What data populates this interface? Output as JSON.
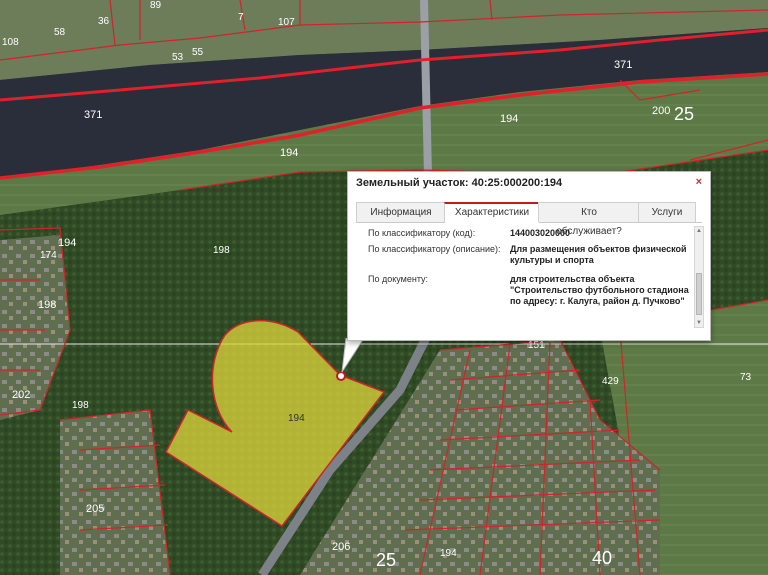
{
  "map": {
    "parcel_labels": [
      "89",
      "36",
      "58",
      "108",
      "107",
      "7",
      "53",
      "55",
      "371",
      "371",
      "194",
      "200",
      "25",
      "194",
      "194",
      "198",
      "174",
      "198",
      "202",
      "198",
      "205",
      "206",
      "25",
      "194",
      "40",
      "73",
      "429",
      "151"
    ],
    "selected_parcel_label": "194"
  },
  "popup": {
    "title": "Земельный участок: 40:25:000200:194",
    "close_icon": "×",
    "tabs": [
      "Информация",
      "Характеристики",
      "Кто обслуживает?",
      "Услуги"
    ],
    "active_tab": "Характеристики",
    "rows": [
      {
        "key": "По классификатору (код):",
        "value": "144003020000"
      },
      {
        "key": "По классификатору (описание):",
        "value": "Для размещения объектов физической культуры и спорта"
      },
      {
        "key": "По документу:",
        "value": "для строительства объекта \"Строительство футбольного стадиона по адресу: г. Калуга, район д. Пучково\""
      }
    ],
    "scroll_up": "▲",
    "scroll_down": "▼"
  },
  "colors": {
    "parcel_border": "#d0242a",
    "selected_fill": "#d8d23a",
    "river": "#2a2d3a",
    "accent": "#c41a1a"
  }
}
